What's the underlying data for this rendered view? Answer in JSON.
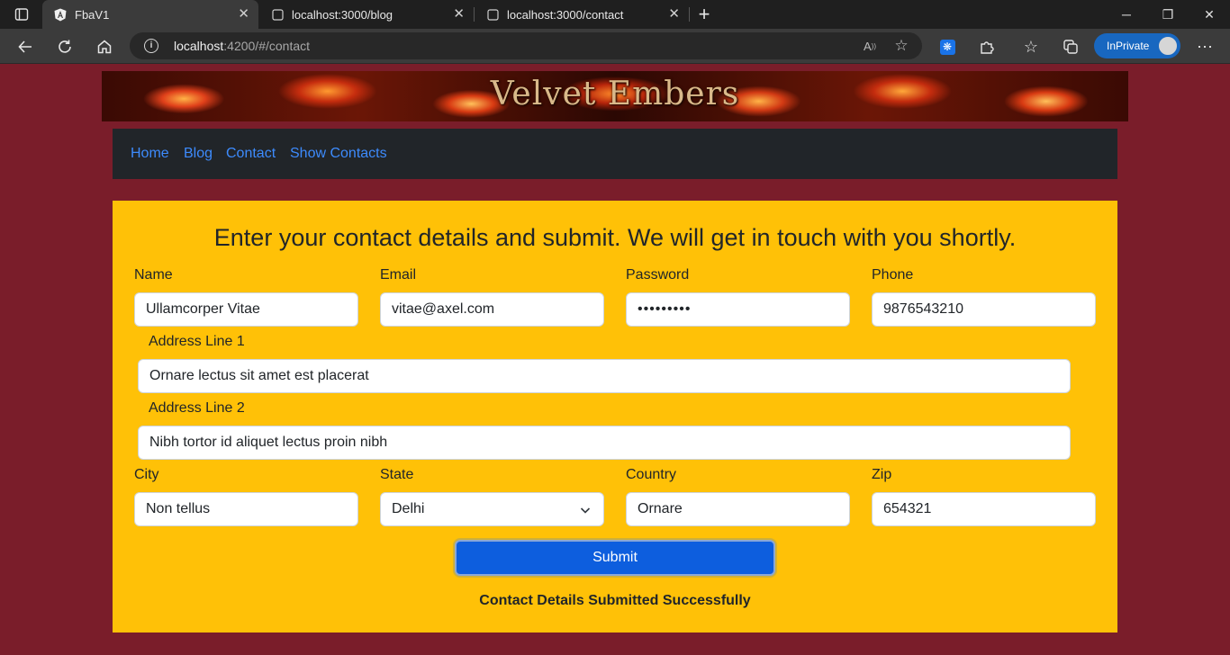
{
  "browser": {
    "tabs": [
      {
        "title": "FbaV1",
        "active": true
      },
      {
        "title": "localhost:3000/blog",
        "active": false
      },
      {
        "title": "localhost:3000/contact",
        "active": false
      }
    ],
    "new_tab": "+",
    "address_host": "localhost",
    "address_path": ":4200/#/contact",
    "inprivate_label": "InPrivate"
  },
  "site": {
    "banner_title": "Velvet Embers",
    "nav": [
      "Home",
      "Blog",
      "Contact",
      "Show Contacts"
    ]
  },
  "form": {
    "heading": "Enter your contact details and submit. We will get in touch with you shortly.",
    "name": {
      "label": "Name",
      "value": "Ullamcorper Vitae"
    },
    "email": {
      "label": "Email",
      "value": "vitae@axel.com"
    },
    "password": {
      "label": "Password",
      "value": "•••••••••"
    },
    "phone": {
      "label": "Phone",
      "value": "9876543210"
    },
    "address1": {
      "label": "Address Line 1",
      "value": "Ornare lectus sit amet est placerat"
    },
    "address2": {
      "label": "Address Line 2",
      "value": "Nibh tortor id aliquet lectus proin nibh"
    },
    "city": {
      "label": "City",
      "value": "Non tellus"
    },
    "state": {
      "label": "State",
      "value": "Delhi"
    },
    "country": {
      "label": "Country",
      "value": "Ornare"
    },
    "zip": {
      "label": "Zip",
      "value": "654321"
    },
    "submit_label": "Submit",
    "status_message": "Contact Details Submitted Successfully"
  },
  "colors": {
    "page_bg": "#7a1d2a",
    "panel_bg": "#ffc107",
    "navbar_bg": "#212529",
    "nav_link": "#3d8bfd",
    "submit_bg": "#0d5ede"
  }
}
